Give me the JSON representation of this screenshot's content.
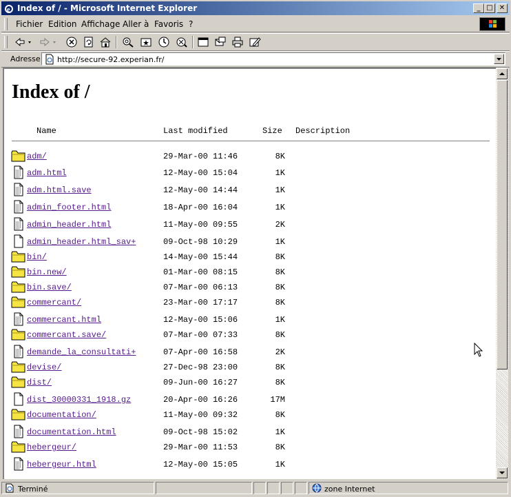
{
  "window": {
    "title": "Index of / - Microsoft Internet Explorer",
    "minimize": "_",
    "maximize": "□",
    "close": "✕"
  },
  "menu": {
    "items": [
      {
        "label": "Fichier"
      },
      {
        "label": "Edition"
      },
      {
        "label": "Affichage"
      },
      {
        "label": "Aller à"
      },
      {
        "label": "Favoris"
      },
      {
        "label": "?"
      }
    ]
  },
  "toolbar": {
    "buttons": [
      "back-icon",
      "forward-icon",
      "stop-icon",
      "refresh-icon",
      "home-icon",
      "search-icon",
      "favorites-icon",
      "history-icon",
      "channels-icon",
      "fullscreen-icon",
      "mail-icon",
      "print-icon",
      "edit-icon"
    ]
  },
  "address": {
    "label": "Adresse",
    "url": "http://secure-92.experian.fr/"
  },
  "page": {
    "title": "Index of /",
    "columns": {
      "name": "Name",
      "modified": "Last modified",
      "size": "Size",
      "description": "Description"
    },
    "files": [
      {
        "name": "adm/",
        "modified": "29-Mar-00 11:46",
        "size": "8K",
        "type": "folder"
      },
      {
        "name": "adm.html",
        "modified": "12-May-00 15:04",
        "size": "1K",
        "type": "text"
      },
      {
        "name": "adm.html.save",
        "modified": "12-May-00 14:44",
        "size": "1K",
        "type": "text"
      },
      {
        "name": "admin_footer.html",
        "modified": "18-Apr-00 16:04",
        "size": "1K",
        "type": "text"
      },
      {
        "name": "admin_header.html",
        "modified": "11-May-00 09:55",
        "size": "2K",
        "type": "text"
      },
      {
        "name": "admin_header.html_sav+",
        "modified": "09-Oct-98 10:29",
        "size": "1K",
        "type": "blank"
      },
      {
        "name": "bin/",
        "modified": "14-May-00 15:44",
        "size": "8K",
        "type": "folder"
      },
      {
        "name": "bin.new/",
        "modified": "01-Mar-00 08:15",
        "size": "8K",
        "type": "folder"
      },
      {
        "name": "bin.save/",
        "modified": "07-Mar-00 06:13",
        "size": "8K",
        "type": "folder"
      },
      {
        "name": "commercant/",
        "modified": "23-Mar-00 17:17",
        "size": "8K",
        "type": "folder"
      },
      {
        "name": "commercant.html",
        "modified": "12-May-00 15:06",
        "size": "1K",
        "type": "text"
      },
      {
        "name": "commercant.save/",
        "modified": "07-Mar-00 07:33",
        "size": "8K",
        "type": "folder"
      },
      {
        "name": "demande_la_consultati+",
        "modified": "07-Apr-00 16:58",
        "size": "2K",
        "type": "text"
      },
      {
        "name": "devise/",
        "modified": "27-Dec-98 23:00",
        "size": "8K",
        "type": "folder"
      },
      {
        "name": "dist/",
        "modified": "09-Jun-00 16:27",
        "size": "8K",
        "type": "folder"
      },
      {
        "name": "dist_30000331_1918.gz",
        "modified": "20-Apr-00 16:26",
        "size": "17M",
        "type": "blank"
      },
      {
        "name": "documentation/",
        "modified": "11-May-00 09:32",
        "size": "8K",
        "type": "folder"
      },
      {
        "name": "documentation.html",
        "modified": "09-Oct-98 15:02",
        "size": "1K",
        "type": "text"
      },
      {
        "name": "hebergeur/",
        "modified": "29-Mar-00 11:53",
        "size": "8K",
        "type": "folder"
      },
      {
        "name": "hebergeur.html",
        "modified": "12-May-00 15:05",
        "size": "1K",
        "type": "text"
      }
    ]
  },
  "status": {
    "text": "Terminé",
    "zone": "zone Internet"
  }
}
